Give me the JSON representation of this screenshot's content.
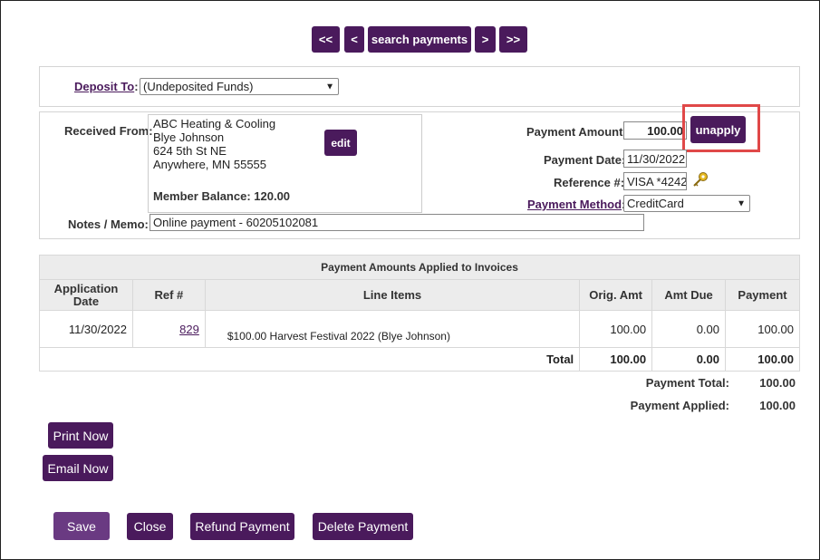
{
  "nav": {
    "first": "<<",
    "prev": "<",
    "search": "search payments",
    "next": ">",
    "last": ">>"
  },
  "deposit": {
    "label": "Deposit To",
    "colon": ":",
    "value": "(Undeposited Funds)"
  },
  "received": {
    "label": "Received From:",
    "lines": [
      "ABC Heating & Cooling",
      "Blye Johnson",
      "624 5th St NE",
      "Anywhere, MN 55555"
    ],
    "balance": "Member Balance: 120.00",
    "edit": "edit"
  },
  "notes": {
    "label": "Notes / Memo:",
    "value": "Online payment - 60205102081"
  },
  "payment": {
    "amount_label": "Payment Amount:",
    "amount": "100.00",
    "unapply": "unapply",
    "date_label": "Payment Date:",
    "date": "11/30/2022",
    "ref_label": "Reference #:",
    "ref": "VISA *4242",
    "method_label": "Payment Method",
    "method_colon": ":",
    "method": "CreditCard"
  },
  "table": {
    "title": "Payment Amounts Applied to Invoices",
    "headers": {
      "date": "Application Date",
      "ref": "Ref #",
      "items": "Line Items",
      "orig": "Orig. Amt",
      "due": "Amt Due",
      "pay": "Payment"
    },
    "rows": [
      {
        "date": "11/30/2022",
        "ref": "829",
        "item": "$100.00 Harvest Festival 2022 (Blye Johnson)",
        "orig": "100.00",
        "due": "0.00",
        "pay": "100.00"
      }
    ],
    "total": {
      "label": "Total",
      "orig": "100.00",
      "due": "0.00",
      "pay": "100.00"
    }
  },
  "summary": {
    "total_label": "Payment Total:",
    "total": "100.00",
    "applied_label": "Payment Applied:",
    "applied": "100.00"
  },
  "actions": {
    "print": "Print Now",
    "email": "Email Now",
    "save": "Save",
    "close": "Close",
    "refund": "Refund Payment",
    "delete": "Delete Payment"
  },
  "icons": {
    "lookup": "key-icon"
  }
}
